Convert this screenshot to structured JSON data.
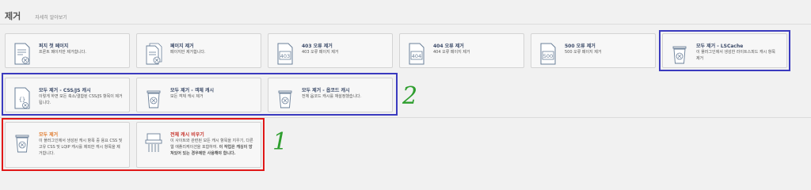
{
  "header": {
    "title": "제거",
    "learn_more": "자세히 알아보기"
  },
  "cards": [
    {
      "id": "front-page",
      "title": "퍼지 첫 페이지",
      "desc": "프론트 페이지만 제거합니다.",
      "icon": "page-purge-icon"
    },
    {
      "id": "pages",
      "title": "페이지 제거",
      "desc": "페이지만 제거합니다.",
      "icon": "pages-purge-icon"
    },
    {
      "id": "403",
      "title": "403 오류 제거",
      "desc": "403 오류 페이지 제거",
      "icon": "error-403-icon",
      "code": "403"
    },
    {
      "id": "404",
      "title": "404 오류 제거",
      "desc": "404 오류 페이지 제거",
      "icon": "error-404-icon",
      "code": "404"
    },
    {
      "id": "500",
      "title": "500 오류 제거",
      "desc": "500 오류 페이지 제거",
      "icon": "error-500-icon",
      "code": "500"
    },
    {
      "id": "lscache",
      "title": "모두 제거 - LSCache",
      "desc": "이 플러그인에서 생성한 라이트스피드 캐시 항목 제거",
      "icon": "trash-bin-icon"
    },
    {
      "id": "cssjs",
      "title": "모두 제거 - CSS/JS 캐시",
      "desc": "이렇게 하면 모든 축소/결합된 CSS/JS 항목이 제거됩니다.",
      "icon": "code-file-icon"
    },
    {
      "id": "object",
      "title": "모두 제거 - 객체 캐시",
      "desc": "모든 객체 캐시 제거",
      "icon": "trash-bin-icon"
    },
    {
      "id": "opcode",
      "title": "모두 제거 - 옵코드 캐시",
      "desc": "전체 옵코드 캐시를 재설정했습니다.",
      "icon": "trash-bin-icon"
    },
    {
      "id": "all",
      "title": "모두 제거",
      "desc": "이 플러그인에서 생성된 캐시 항목 중 용요 CSS 및 고유 CSS 및 LQIP 캐시를 제외한 캐시 항목을 제거합니다.",
      "icon": "trash-bin-icon",
      "accent": "#e07b2d"
    },
    {
      "id": "empty",
      "title": "전체 캐시 비우기",
      "desc": "이 사이트와 관련된 모든 캐시 항목을 지우기, 다른 웹 애플리케이션을 포함하여.",
      "desc_bold": "이 작업은 캐싱이 망쳐있어 있는 경우에만 사용해야 합니다.",
      "icon": "shredder-icon",
      "accent": "#c6342c"
    }
  ],
  "annotations": {
    "one": "1",
    "two": "2"
  },
  "colors": {
    "blue_frame": "#3b3bbf",
    "red_frame": "#e01818",
    "green_annotation": "#2e9e2e"
  }
}
